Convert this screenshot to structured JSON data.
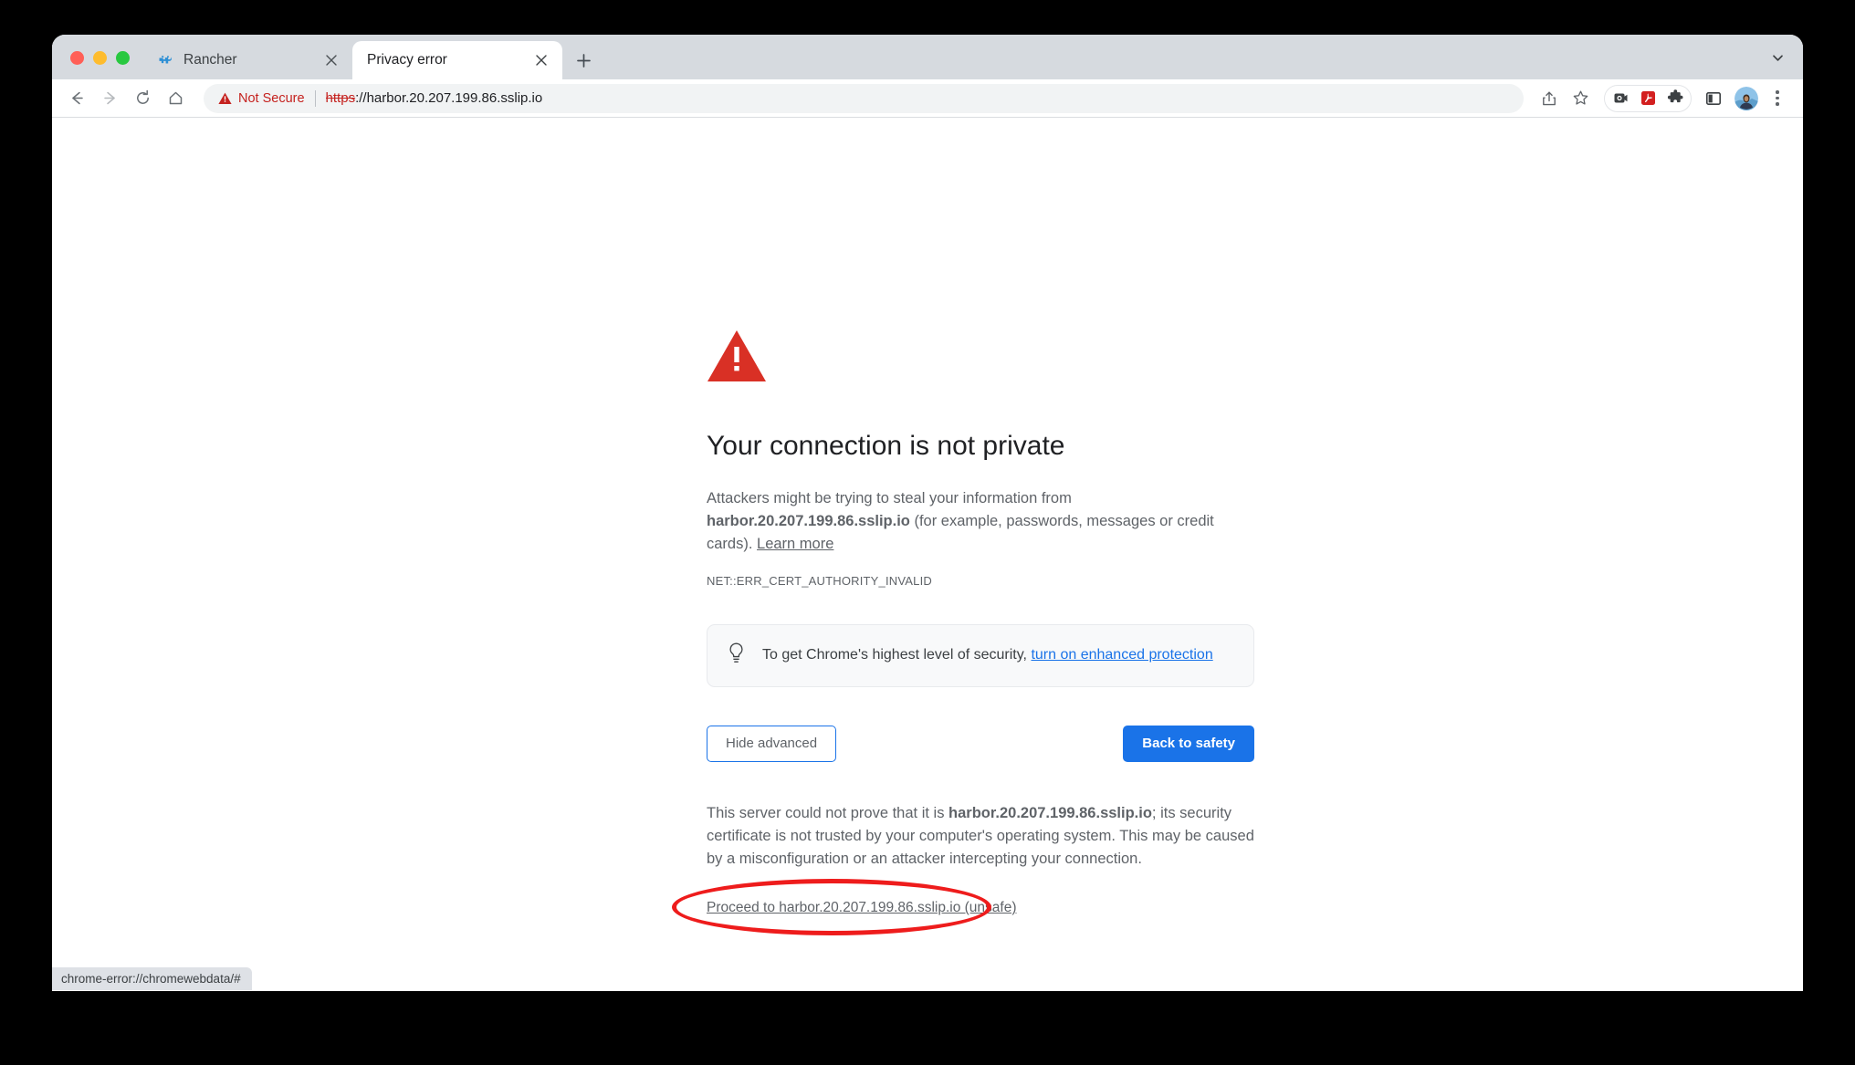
{
  "window": {
    "traffic_lights": [
      "close",
      "minimize",
      "maximize"
    ]
  },
  "tabstrip": {
    "tabs": [
      {
        "title": "Rancher",
        "favicon": "rancher-icon",
        "active": false
      },
      {
        "title": "Privacy error",
        "favicon": "none",
        "active": true
      }
    ],
    "new_tab_label": "+",
    "tab_search_label": "∨"
  },
  "toolbar": {
    "back_label": "←",
    "forward_label": "→",
    "reload_label": "⟳",
    "home_label": "⌂",
    "security": {
      "status_text": "Not Secure",
      "status_color": "#c5221f"
    },
    "url": {
      "scheme": "https",
      "rest": "://harbor.20.207.199.86.sslip.io",
      "full": "https://harbor.20.207.199.86.sslip.io"
    },
    "icons": [
      "share-icon",
      "bookmark-star-icon",
      "screencast-extension-icon",
      "adobe-acrobat-extension-icon",
      "extensions-puzzle-icon",
      "side-panel-icon",
      "profile-avatar",
      "chrome-menu-kebab-icon"
    ]
  },
  "interstitial": {
    "icon": "red-warning-triangle",
    "title": "Your connection is not private",
    "paragraph_prefix": "Attackers might be trying to steal your information from ",
    "host": "harbor.20.207.199.86.sslip.io",
    "paragraph_suffix": " (for example, passwords, messages or credit cards). ",
    "learn_more": "Learn more",
    "error_code": "NET::ERR_CERT_AUTHORITY_INVALID",
    "enhanced": {
      "icon": "lightbulb-icon",
      "text": "To get Chrome's highest level of security, ",
      "link": "turn on enhanced protection"
    },
    "buttons": {
      "advanced": "Hide advanced",
      "safety": "Back to safety"
    },
    "advanced": {
      "text_prefix": "This server could not prove that it is ",
      "host": "harbor.20.207.199.86.sslip.io",
      "text_suffix": "; its security certificate is not trusted by your computer's operating system. This may be caused by a misconfiguration or an attacker intercepting your connection.",
      "proceed_link": "Proceed to harbor.20.207.199.86.sslip.io (unsafe)",
      "annotation": "red-ellipse-highlight"
    }
  },
  "statusbar": {
    "text": "chrome-error://chromewebdata/#"
  },
  "colors": {
    "accent_blue": "#1a73e8",
    "danger_red": "#c5221f",
    "warning_triangle": "#d93025",
    "annotation_red": "#ee1c1c",
    "tabstrip_bg": "#d6dadf",
    "omnibox_bg": "#f1f3f4"
  }
}
